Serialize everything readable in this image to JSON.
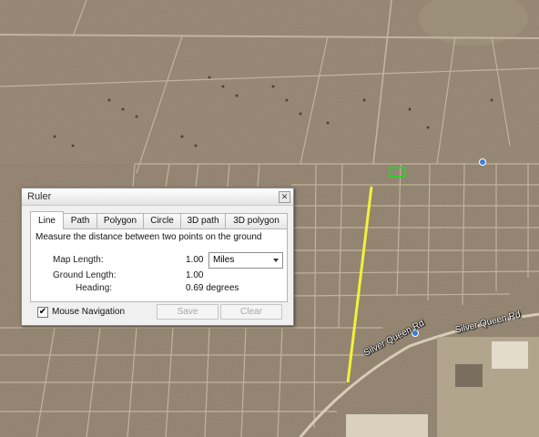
{
  "map": {
    "road_labels": [
      "Silver Queen Rd",
      "Silver Queen Rd"
    ],
    "colors": {
      "ruler_line": "#f2f23a",
      "placemark": "#33cc33",
      "terrain": "#8c7d68"
    }
  },
  "ruler": {
    "title": "Ruler",
    "close_icon": "✕",
    "tabs": [
      "Line",
      "Path",
      "Polygon",
      "Circle",
      "3D path",
      "3D polygon"
    ],
    "active_tab": "Line",
    "description": "Measure the distance between two points on the ground",
    "map_length_label": "Map Length:",
    "map_length_value": "1.00",
    "unit": "Miles",
    "ground_length_label": "Ground Length:",
    "ground_length_value": "1.00",
    "heading_label": "Heading:",
    "heading_value": "0.69 degrees",
    "mouse_nav_label": "Mouse Navigation",
    "mouse_nav_checked": "✔",
    "save_label": "Save",
    "clear_label": "Clear"
  }
}
